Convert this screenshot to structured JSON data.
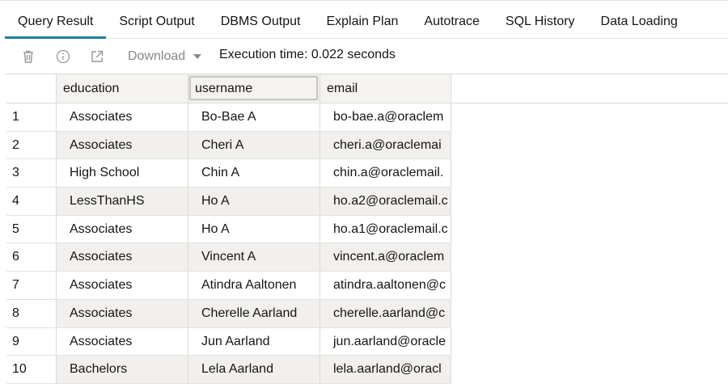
{
  "tabs": [
    {
      "label": "Query Result",
      "active": true
    },
    {
      "label": "Script Output"
    },
    {
      "label": "DBMS Output"
    },
    {
      "label": "Explain Plan"
    },
    {
      "label": "Autotrace"
    },
    {
      "label": "SQL History"
    },
    {
      "label": "Data Loading"
    }
  ],
  "toolbar": {
    "download_label": "Download",
    "execution_time": "Execution time: 0.022 seconds",
    "icons": [
      "trash-icon",
      "info-icon",
      "open-external-icon",
      "chevron-down-icon"
    ]
  },
  "grid": {
    "columns": [
      "education",
      "username",
      "email"
    ],
    "rows": [
      {
        "n": "1",
        "education": "Associates",
        "username": "Bo-Bae A",
        "email": "bo-bae.a@oraclem"
      },
      {
        "n": "2",
        "education": "Associates",
        "username": "Cheri A",
        "email": "cheri.a@oraclemai"
      },
      {
        "n": "3",
        "education": "High School",
        "username": "Chin A",
        "email": "chin.a@oraclemail."
      },
      {
        "n": "4",
        "education": "LessThanHS",
        "username": "Ho A",
        "email": "ho.a2@oraclemail.c"
      },
      {
        "n": "5",
        "education": "Associates",
        "username": "Ho A",
        "email": "ho.a1@oraclemail.c"
      },
      {
        "n": "6",
        "education": "Associates",
        "username": "Vincent A",
        "email": "vincent.a@oraclem"
      },
      {
        "n": "7",
        "education": "Associates",
        "username": "Atindra Aaltonen",
        "email": "atindra.aaltonen@c"
      },
      {
        "n": "8",
        "education": "Associates",
        "username": "Cherelle Aarland",
        "email": "cherelle.aarland@c"
      },
      {
        "n": "9",
        "education": "Associates",
        "username": "Jun Aarland",
        "email": "jun.aarland@oracle"
      },
      {
        "n": "10",
        "education": "Bachelors",
        "username": "Lela Aarland",
        "email": "lela.aarland@oracl"
      }
    ]
  },
  "colors": {
    "accent": "#227e9e",
    "alt_row": "#f1f0ee"
  }
}
